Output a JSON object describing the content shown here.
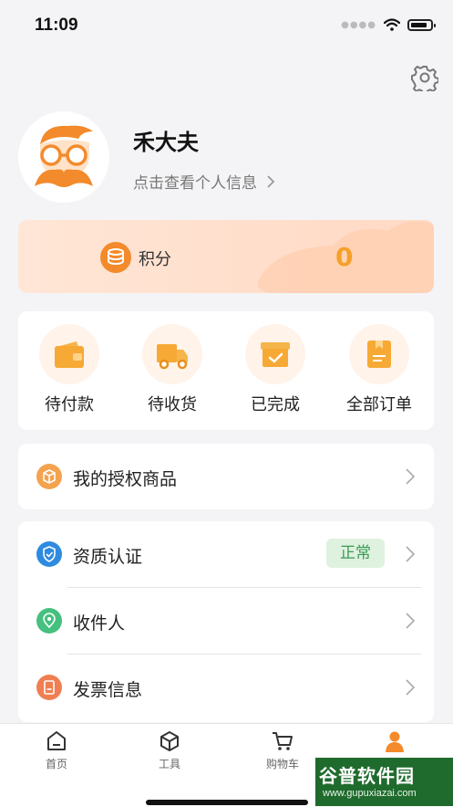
{
  "status_bar": {
    "time": "11:09"
  },
  "user": {
    "name": "禾大夫",
    "profile_link": "点击查看个人信息"
  },
  "points": {
    "label": "积分",
    "value": "0"
  },
  "orders": [
    {
      "label": "待付款",
      "icon": "wallet-icon"
    },
    {
      "label": "待收货",
      "icon": "truck-icon"
    },
    {
      "label": "已完成",
      "icon": "box-check-icon"
    },
    {
      "label": "全部订单",
      "icon": "package-icon"
    }
  ],
  "menu_single": {
    "label": "我的授权商品",
    "icon": "cube-icon"
  },
  "menu_group": [
    {
      "label": "资质认证",
      "icon": "shield-check-icon",
      "badge": "正常"
    },
    {
      "label": "收件人",
      "icon": "location-pin-icon"
    },
    {
      "label": "发票信息",
      "icon": "invoice-icon"
    }
  ],
  "tabbar": [
    {
      "label": "首页",
      "icon": "home-icon"
    },
    {
      "label": "工具",
      "icon": "cube-outline-icon"
    },
    {
      "label": "购物车",
      "icon": "cart-icon"
    },
    {
      "label": "我的",
      "icon": "person-icon",
      "active": true
    }
  ],
  "watermark": {
    "title": "谷普软件园",
    "url": "www.gupuxiazai.com"
  },
  "colors": {
    "accent": "#f38a2b",
    "badge_bg": "#dff1df",
    "badge_text": "#3b9a55",
    "background": "#f4f4f6"
  }
}
